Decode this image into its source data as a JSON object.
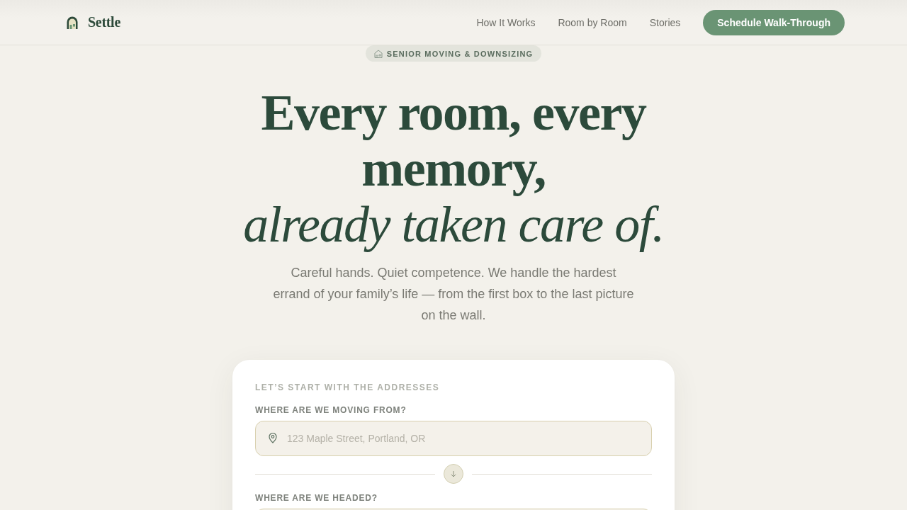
{
  "header": {
    "brand": "Settle",
    "nav_links": [
      {
        "label": "How It Works"
      },
      {
        "label": "Room by Room"
      },
      {
        "label": "Stories"
      }
    ],
    "cta": "Schedule Walk-Through"
  },
  "hero": {
    "badge": "SENIOR MOVING & DOWNSIZING",
    "headline": "Every room, every memory,",
    "headline_emphasis": "already taken care of.",
    "subtitle": "Careful hands. Quiet competence. We handle the hardest errand of your family’s life — from the first box to the last picture on the wall."
  },
  "address_card": {
    "title": "LET’S START WITH THE ADDRESSES",
    "fields": [
      {
        "label": "WHERE ARE WE MOVING FROM?",
        "placeholder": "123 Maple Street, Portland, OR"
      },
      {
        "label": "WHERE ARE WE HEADED?"
      }
    ]
  }
}
